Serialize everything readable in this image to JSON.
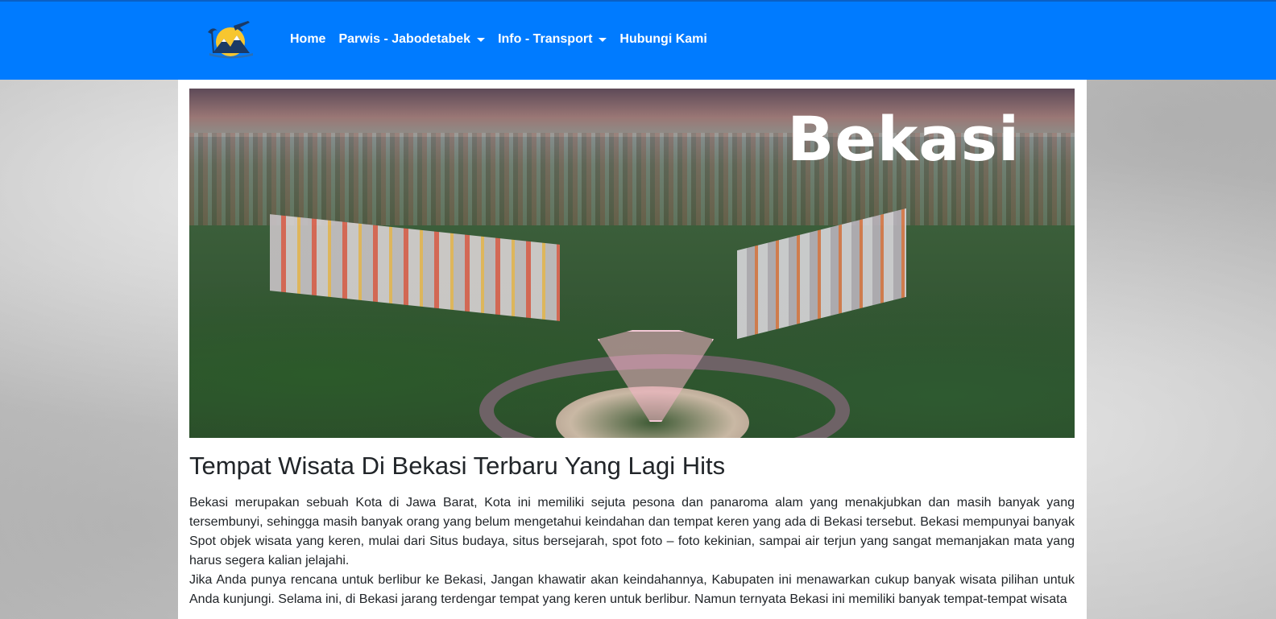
{
  "navbar": {
    "logo_icon": "travel-beach-airplane-logo-icon",
    "items": [
      {
        "label": "Home",
        "dropdown": false
      },
      {
        "label": "Parwis - Jabodetabek",
        "dropdown": true
      },
      {
        "label": "Info - Transport",
        "dropdown": true
      },
      {
        "label": "Hubungi Kami",
        "dropdown": false
      }
    ],
    "background_color": "#007bff"
  },
  "hero": {
    "title": "Bekasi"
  },
  "main": {
    "heading": "Tempat Wisata Di Bekasi Terbaru Yang Lagi Hits",
    "paragraphs": [
      "Bekasi merupakan sebuah Kota di Jawa Barat, Kota ini memiliki sejuta pesona dan panaroma alam yang menakjubkan dan masih banyak yang tersembunyi, sehingga masih banyak orang yang belum mengetahui keindahan dan tempat keren yang ada di Bekasi tersebut. Bekasi mempunyai banyak Spot objek wisata yang keren, mulai dari Situs budaya, situs bersejarah, spot foto – foto kekinian, sampai air terjun yang sangat memanjakan mata yang harus segera kalian jelajahi.",
      "Jika Anda punya rencana untuk berlibur ke Bekasi, Jangan khawatir akan keindahannya, Kabupaten ini menawarkan cukup banyak wisata pilihan untuk Anda kunjungi. Selama ini, di Bekasi jarang terdengar tempat yang keren untuk berlibur. Namun ternyata Bekasi ini memiliki banyak tempat-tempat wisata"
    ]
  }
}
